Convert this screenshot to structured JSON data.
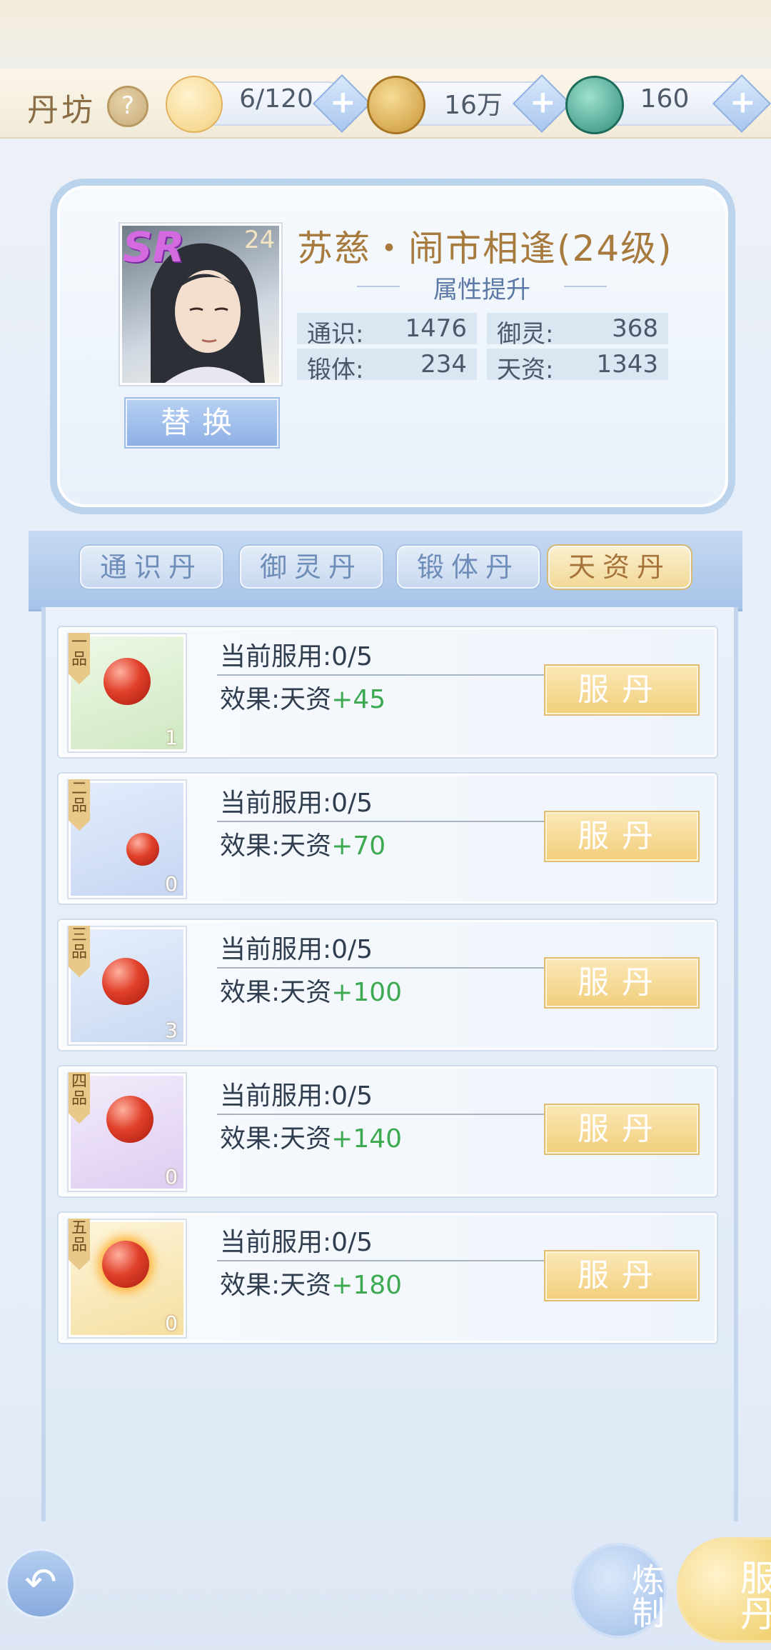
{
  "header": {
    "title": "丹坊",
    "help_icon": "?",
    "resources": [
      {
        "icon": "cat-face-icon",
        "value": "6/120"
      },
      {
        "icon": "gold-coin-icon",
        "value": "16万"
      },
      {
        "icon": "jade-serpent-icon",
        "value": "160"
      }
    ],
    "plus_label": "+"
  },
  "character": {
    "rarity": "SR",
    "level": "24",
    "name": "苏慈・闹市相逢(24级)",
    "subtitle": "属性提升",
    "swap_label": "替换",
    "stats": [
      {
        "label": "通识:",
        "value": "1476"
      },
      {
        "label": "御灵:",
        "value": "368"
      },
      {
        "label": "锻体:",
        "value": "234"
      },
      {
        "label": "天资:",
        "value": "1343"
      }
    ]
  },
  "tabs": [
    {
      "label": "通识丹",
      "active": false
    },
    {
      "label": "御灵丹",
      "active": false
    },
    {
      "label": "锻体丹",
      "active": false
    },
    {
      "label": "天资丹",
      "active": true
    }
  ],
  "pills": [
    {
      "grade": "一品",
      "count": "1",
      "used_label": "当前服用:",
      "used": "0/5",
      "effect_label": "效果:",
      "effect_attr": "天资",
      "bonus": "+45",
      "button": "服丹",
      "bg": "#dff0d8"
    },
    {
      "grade": "二品",
      "count": "0",
      "used_label": "当前服用:",
      "used": "0/5",
      "effect_label": "效果:",
      "effect_attr": "天资",
      "bonus": "+70",
      "button": "服丹",
      "bg": "#d6e3f8"
    },
    {
      "grade": "三品",
      "count": "3",
      "used_label": "当前服用:",
      "used": "0/5",
      "effect_label": "效果:",
      "effect_attr": "天资",
      "bonus": "+100",
      "button": "服丹",
      "bg": "#d9e6f8"
    },
    {
      "grade": "四品",
      "count": "0",
      "used_label": "当前服用:",
      "used": "0/5",
      "effect_label": "效果:",
      "effect_attr": "天资",
      "bonus": "+140",
      "button": "服丹",
      "bg": "#ece1f6"
    },
    {
      "grade": "五品",
      "count": "0",
      "used_label": "当前服用:",
      "used": "0/5",
      "effect_label": "效果:",
      "effect_attr": "天资",
      "bonus": "+180",
      "button": "服丹",
      "bg": "#f8ecc8"
    }
  ],
  "bottom": {
    "back_icon": "↶",
    "refine_label": "炼制",
    "take_label": "服丹"
  }
}
